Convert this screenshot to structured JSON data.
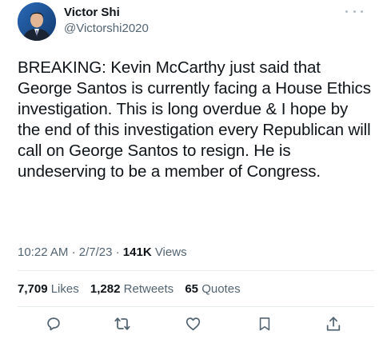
{
  "tweet": {
    "author": {
      "display_name": "Victor Shi",
      "handle": "@Victorshi2020"
    },
    "text": "BREAKING: Kevin McCarthy just said that George Santos is currently facing a House Ethics investigation. This is long overdue & I hope by the end of this investigation every Republican will call on George Santos to resign. He is undeserving to be a member of Congress.",
    "time": "10:22 AM",
    "date": "2/7/23",
    "separator": "·",
    "views_count": "141K",
    "views_label": "Views",
    "stats": {
      "likes_count": "7,709",
      "likes_label": "Likes",
      "retweets_count": "1,282",
      "retweets_label": "Retweets",
      "quotes_count": "65",
      "quotes_label": "Quotes"
    },
    "icons": {
      "more": "more-horizontal-icon",
      "reply": "reply-icon",
      "retweet": "retweet-icon",
      "like": "like-icon",
      "bookmark": "bookmark-icon",
      "share": "share-icon"
    },
    "colors": {
      "text": "#0f1419",
      "secondary": "#536471",
      "icon": "#536471",
      "avatar_bg": "#1d4f8c"
    }
  }
}
